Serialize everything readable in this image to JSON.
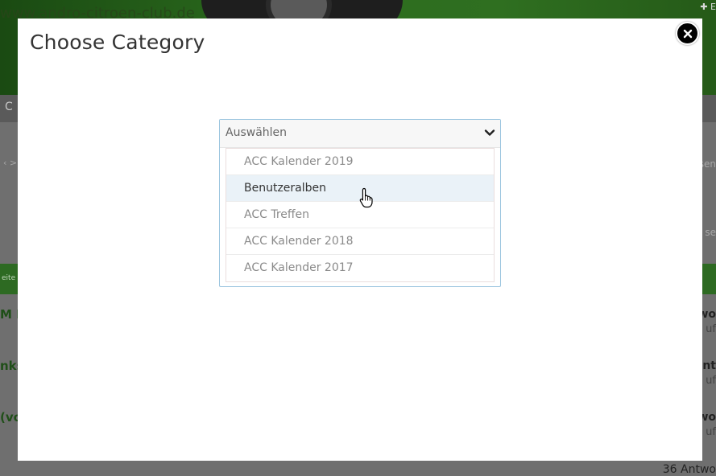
{
  "background": {
    "site_text": "www.andro-citroen-club.de",
    "nav_item": "C",
    "top_right": "✚ E",
    "breadcrumb": "‹ > ",
    "right_snippets": [
      "sen",
      "se"
    ],
    "green_bar_text": "eite",
    "topics": [
      "M E",
      "nks",
      "(vo"
    ],
    "replies": [
      "two",
      "nt",
      "two"
    ],
    "reply_subs": [
      "uf",
      "uf",
      "uf"
    ],
    "bottom_text": "36 Antwo"
  },
  "modal": {
    "title": "Choose Category",
    "close_icon": "close-icon",
    "select": {
      "value": "Auswählen",
      "chevron_icon": "chevron-down-icon",
      "options": [
        "ACC Kalender 2019",
        "Benutzeralben",
        "ACC Treffen",
        "ACC Kalender 2018",
        "ACC Kalender 2017"
      ],
      "hovered_index": 1
    }
  },
  "colors": {
    "dropdown_border": "#9bc5df",
    "hover_background": "#eaf2f8",
    "header_green": "#2f6f20"
  }
}
